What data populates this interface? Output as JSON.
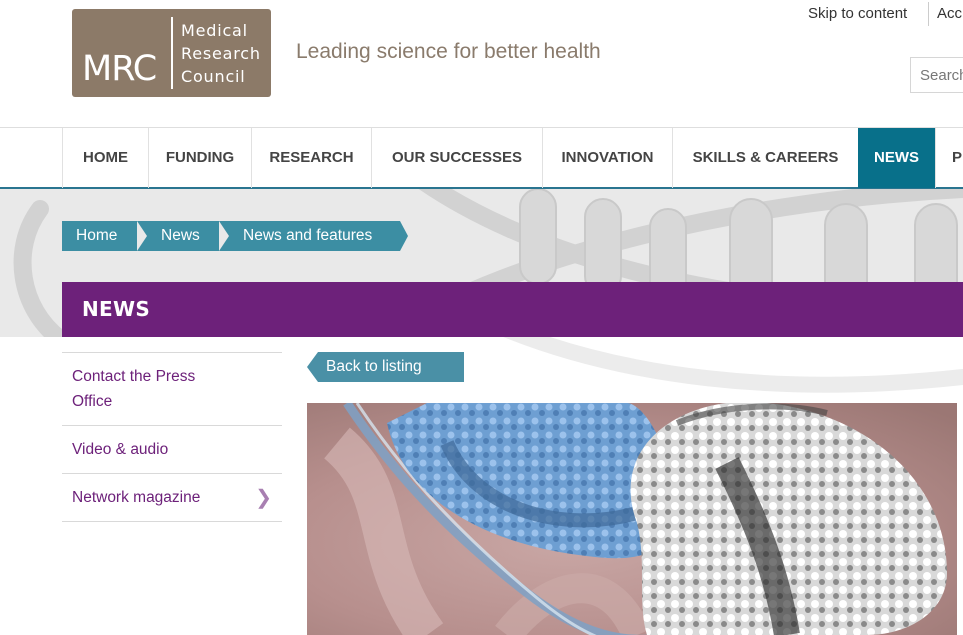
{
  "header": {
    "logo_abbrev": "MRC",
    "logo_words": [
      "Medical",
      "Research",
      "Council"
    ],
    "tagline": "Leading science for better health",
    "skip_link": "Skip to content",
    "utility_link_partial": "Acc",
    "search_placeholder": "Search"
  },
  "nav": {
    "items": [
      {
        "label": "HOME"
      },
      {
        "label": "FUNDING"
      },
      {
        "label": "RESEARCH"
      },
      {
        "label": "OUR SUCCESSES"
      },
      {
        "label": "INNOVATION"
      },
      {
        "label": "SKILLS & CAREERS"
      },
      {
        "label": "NEWS",
        "active": true
      },
      {
        "label": "P"
      }
    ]
  },
  "breadcrumb": [
    "Home",
    "News",
    "News and features"
  ],
  "section_title": "NEWS",
  "sidebar": {
    "items": [
      {
        "label": "Contact the Press Office"
      },
      {
        "label": "Video & audio"
      },
      {
        "label": "Network magazine",
        "has_children": true
      }
    ]
  },
  "main": {
    "back_label": "Back to listing"
  },
  "colors": {
    "brand_brown": "#8c7a68",
    "nav_active": "#08708a",
    "breadcrumb": "#3c8ea3",
    "news_band": "#6d217a",
    "sidebar_link": "#6d217a"
  },
  "icons": {
    "sidebar_chevron": "chevron-right-icon",
    "breadcrumb_separator": "arrow-separator"
  }
}
